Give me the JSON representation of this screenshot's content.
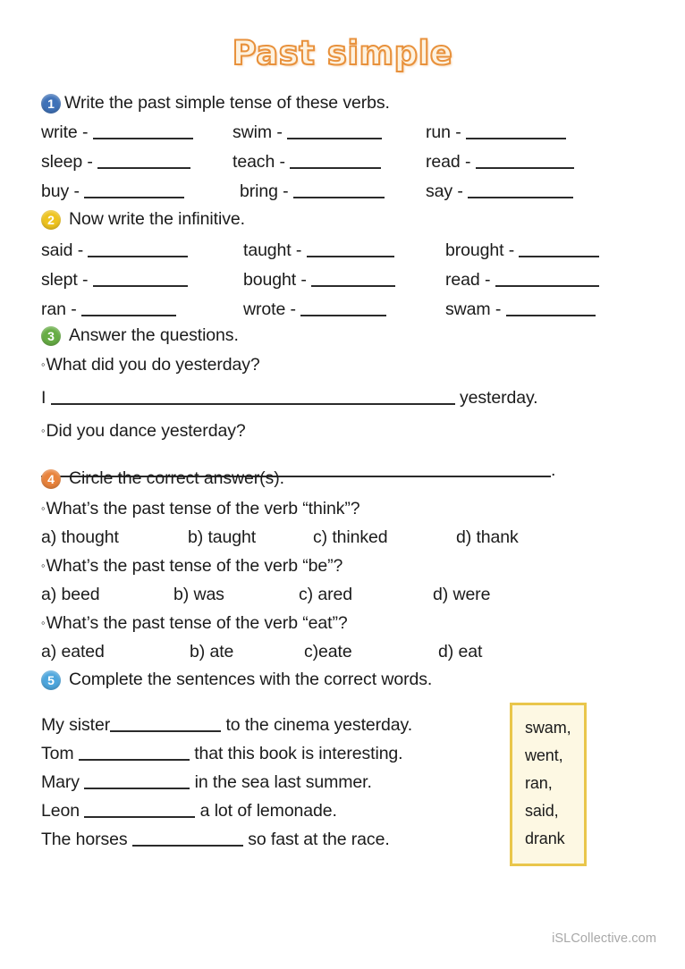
{
  "title": "Past simple",
  "footer": "iSLCollective.com",
  "colors": {
    "circle1": "#3f72b8",
    "circle2": "#eec31f",
    "circle3": "#67ad45",
    "circle4": "#e8833c",
    "circle5": "#4da6dd",
    "title_fill": "#fdf2e0",
    "title_outline": "#e8913c",
    "wordbox_fill": "#fdf8e3",
    "wordbox_border": "#e9c64b",
    "footer_text": "#a8a8a8"
  },
  "exercises": [
    {
      "number": "1",
      "instruction": "Write the past simple tense of these verbs.",
      "items": [
        "write -",
        "swim -",
        "run -",
        "sleep -",
        "teach -",
        "read -",
        "buy -",
        "bring -",
        "say -"
      ]
    },
    {
      "number": "2",
      "instruction": "Now write the infinitive.",
      "items": [
        "said -",
        "taught -",
        "brought -",
        "slept -",
        "bought -",
        "read -",
        "ran -",
        "wrote -",
        "swam -"
      ]
    },
    {
      "number": "3",
      "instruction": "Answer the questions.",
      "questions": [
        "What did you do yesterday?",
        "Did you dance yesterday?"
      ],
      "answer_prefix": "I",
      "answer_suffix": "yesterday.",
      "answer_end": "."
    },
    {
      "number": "4",
      "instruction": "Circle the correct answer(s).",
      "questions": [
        {
          "prompt": "What’s the past tense of the verb “think”?",
          "options": [
            "a) thought",
            "b) taught",
            "c) thinked",
            "d) thank"
          ]
        },
        {
          "prompt": "What’s the past tense of the verb “be”?",
          "options": [
            "a) beed",
            "b) was",
            "c) ared",
            "d) were"
          ]
        },
        {
          "prompt": "What’s the past tense of the verb “eat”?",
          "options": [
            "a) eated",
            "b) ate",
            "c)eate",
            "d) eat"
          ]
        }
      ]
    },
    {
      "number": "5",
      "instruction": "Complete the sentences with the correct words.",
      "sentences": [
        {
          "before": "My sister",
          "after": "to the cinema yesterday."
        },
        {
          "before": "Tom",
          "after": "that this book is interesting."
        },
        {
          "before": "Mary",
          "after": "in the sea last summer."
        },
        {
          "before": "Leon",
          "after": "a lot of lemonade."
        },
        {
          "before": "The horses",
          "after": "so fast at the race."
        }
      ],
      "wordbank": [
        "swam,",
        "went,",
        "ran,",
        "said,",
        "drank"
      ]
    }
  ]
}
